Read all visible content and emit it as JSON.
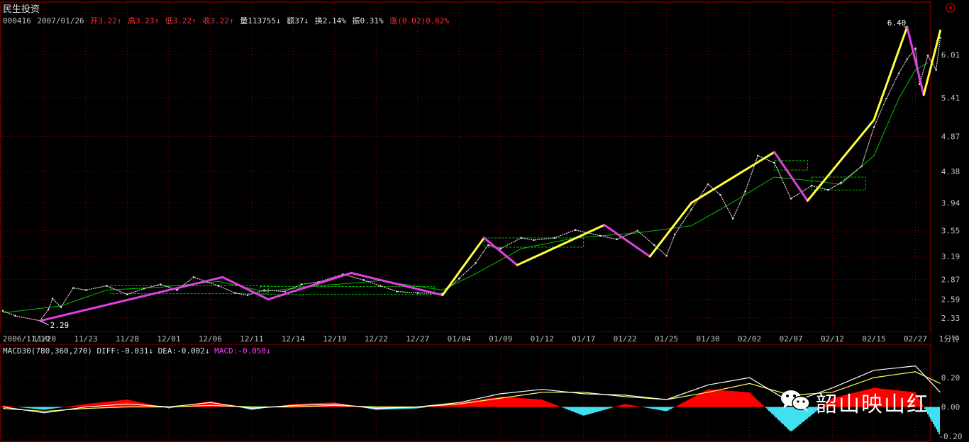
{
  "header": {
    "title": "民生投资",
    "quote": {
      "code": "000416",
      "date": "2007/01/26",
      "open_label": "开",
      "open": "3.22",
      "high_label": "高",
      "high": "3.23",
      "low_label": "低",
      "low": "3.22",
      "close_label": "收",
      "close": "3.22",
      "volume_label": "量",
      "volume": "113755",
      "amount_label": "额",
      "amount": "37",
      "turnover_label": "换",
      "turnover": "2.14%",
      "amplitude_label": "振",
      "amplitude": "0.31%",
      "change_label": "涨",
      "change": "(0.02)0.62%"
    }
  },
  "macd_header": {
    "name": "MACD30(780,360,270)",
    "diff_label": "DIFF:",
    "diff": "-0.031",
    "dea_label": "DEA:",
    "dea": "-0.002",
    "macd_label": "MACD:",
    "macd": "-0.058"
  },
  "watermark": "韶山映山红",
  "colors": {
    "background": "#000000",
    "grid": "#8b0000",
    "axis_text": "#c0c0c0",
    "price_line": "#dcdcdc",
    "ma_line": "#00c000",
    "zigzag_up": "#ffff40",
    "zigzag_down": "#e040e0",
    "box": "#00c000",
    "hist_pos": "#ff0000",
    "hist_neg": "#40e0f0",
    "diff_line": "#ffffff",
    "dea_line": "#ffff60",
    "quote_up": "#ff3030"
  },
  "chart_data": [
    {
      "type": "line",
      "panel": "price",
      "x_ticks": [
        "2006/11/10",
        "11/20",
        "11/23",
        "11/28",
        "12/01",
        "12/06",
        "12/11",
        "12/14",
        "12/19",
        "12/22",
        "12/27",
        "01/04",
        "01/09",
        "01/12",
        "01/17",
        "01/22",
        "01/25",
        "01/30",
        "02/02",
        "02/07",
        "02/12",
        "02/15",
        "02/27"
      ],
      "x_unit": "1分钟",
      "y_ticks": [
        2.33,
        2.59,
        2.87,
        3.19,
        3.55,
        3.94,
        4.38,
        4.87,
        5.41,
        6.01
      ],
      "ylim": [
        2.2,
        6.5
      ],
      "annotations": [
        {
          "text": "2.29",
          "x": 0.9,
          "y": 2.29
        },
        {
          "text": "6.40",
          "x": 21.8,
          "y": 6.4
        }
      ],
      "series": [
        {
          "role": "price",
          "x": [
            0,
            0.3,
            0.9,
            1.1,
            1.2,
            1.4,
            1.7,
            2.0,
            2.5,
            3.0,
            3.4,
            3.8,
            4.2,
            4.6,
            5.2,
            5.6,
            5.9,
            6.3,
            6.8,
            7.2,
            7.6,
            8.2,
            8.7,
            9.1,
            9.5,
            10.0,
            10.6,
            11.0,
            11.4,
            11.7,
            12.0,
            12.5,
            12.8,
            13.3,
            13.8,
            14.4,
            14.8,
            15.3,
            15.7,
            16.0,
            16.2,
            16.6,
            17.0,
            17.3,
            17.6,
            17.9,
            18.2,
            18.6,
            19.0,
            19.5,
            19.9,
            20.2,
            20.7,
            21.0,
            21.3,
            21.6,
            21.8,
            22.0,
            22.1,
            22.3,
            22.5,
            22.6
          ],
          "y": [
            2.43,
            2.36,
            2.29,
            2.45,
            2.6,
            2.48,
            2.75,
            2.72,
            2.78,
            2.66,
            2.74,
            2.8,
            2.72,
            2.9,
            2.78,
            2.68,
            2.65,
            2.72,
            2.7,
            2.8,
            2.83,
            2.94,
            2.86,
            2.78,
            2.7,
            2.68,
            2.67,
            2.88,
            3.1,
            3.35,
            3.3,
            3.45,
            3.42,
            3.45,
            3.56,
            3.48,
            3.43,
            3.55,
            3.35,
            3.2,
            3.5,
            3.85,
            4.2,
            4.05,
            3.72,
            4.1,
            4.6,
            4.5,
            4.0,
            4.18,
            4.12,
            4.22,
            4.45,
            5.0,
            5.4,
            5.75,
            5.95,
            6.1,
            5.6,
            6.0,
            5.8,
            6.25
          ]
        },
        {
          "role": "moving-average",
          "x": [
            0,
            1.4,
            2.5,
            3.8,
            5.2,
            6.3,
            7.6,
            9.1,
            10.6,
            11.4,
            12.5,
            13.8,
            15.3,
            16.6,
            17.6,
            18.6,
            19.5,
            20.2,
            21.0,
            21.6,
            22.0,
            22.3
          ],
          "y": [
            2.4,
            2.5,
            2.72,
            2.76,
            2.84,
            2.7,
            2.78,
            2.85,
            2.72,
            2.95,
            3.3,
            3.45,
            3.52,
            3.62,
            3.95,
            4.3,
            4.25,
            4.2,
            4.6,
            5.4,
            5.8,
            5.9
          ]
        },
        {
          "role": "zigzag",
          "x": [
            0.9,
            5.3,
            6.4,
            8.4,
            10.6,
            11.6,
            12.4,
            14.5,
            15.6,
            16.6,
            18.6,
            19.4,
            21.0,
            21.8,
            22.2,
            22.6
          ],
          "y": [
            2.29,
            2.9,
            2.59,
            2.96,
            2.65,
            3.45,
            3.07,
            3.63,
            3.19,
            3.94,
            4.65,
            3.97,
            5.1,
            6.4,
            5.45,
            6.35
          ]
        }
      ],
      "boxes": [
        {
          "x": [
            2.6,
            6.4
          ],
          "y": [
            2.67,
            2.78
          ]
        },
        {
          "x": [
            6.2,
            10.4
          ],
          "y": [
            2.66,
            2.77
          ]
        },
        {
          "x": [
            11.6,
            14.0
          ],
          "y": [
            3.32,
            3.45
          ]
        },
        {
          "x": [
            18.6,
            19.4
          ],
          "y": [
            4.4,
            4.53
          ]
        },
        {
          "x": [
            19.5,
            20.8
          ],
          "y": [
            4.12,
            4.3
          ]
        }
      ]
    },
    {
      "type": "line",
      "panel": "macd",
      "title": "MACD30(780,360,270)",
      "y_ticks": [
        0.2,
        0.0,
        -0.2
      ],
      "ylim": [
        -0.22,
        0.36
      ],
      "series": [
        {
          "name": "DIFF",
          "x": [
            0,
            1,
            2,
            3,
            4,
            5,
            6,
            7,
            8,
            9,
            10,
            11,
            12,
            13,
            14,
            15,
            16,
            17,
            18,
            19,
            20,
            21,
            22,
            22.6
          ],
          "y": [
            0.0,
            -0.04,
            0.0,
            0.02,
            0.0,
            0.03,
            -0.01,
            0.01,
            0.02,
            -0.01,
            0.0,
            0.03,
            0.09,
            0.12,
            0.09,
            0.08,
            0.05,
            0.15,
            0.2,
            0.03,
            0.13,
            0.25,
            0.28,
            0.1
          ]
        },
        {
          "name": "DEA",
          "x": [
            0,
            1,
            2,
            3,
            4,
            5,
            6,
            7,
            8,
            9,
            10,
            11,
            12,
            13,
            14,
            15,
            16,
            17,
            18,
            19,
            20,
            21,
            22,
            22.6
          ],
          "y": [
            -0.01,
            -0.03,
            -0.01,
            0.0,
            0.0,
            0.01,
            0.0,
            0.0,
            0.01,
            0.0,
            0.0,
            0.02,
            0.06,
            0.1,
            0.1,
            0.07,
            0.05,
            0.1,
            0.16,
            0.08,
            0.1,
            0.2,
            0.24,
            0.16
          ]
        },
        {
          "name": "MACD",
          "x": [
            0,
            1,
            2,
            3,
            4,
            5,
            6,
            7,
            8,
            9,
            10,
            11,
            12,
            13,
            14,
            15,
            16,
            17,
            18,
            19,
            20,
            21,
            22,
            22.6
          ],
          "y": [
            0.01,
            -0.02,
            0.02,
            0.05,
            -0.01,
            0.04,
            -0.02,
            0.02,
            0.03,
            -0.02,
            -0.01,
            0.03,
            0.07,
            0.05,
            -0.06,
            0.02,
            -0.03,
            0.12,
            0.1,
            -0.17,
            0.06,
            0.13,
            0.1,
            -0.2
          ]
        }
      ]
    }
  ]
}
